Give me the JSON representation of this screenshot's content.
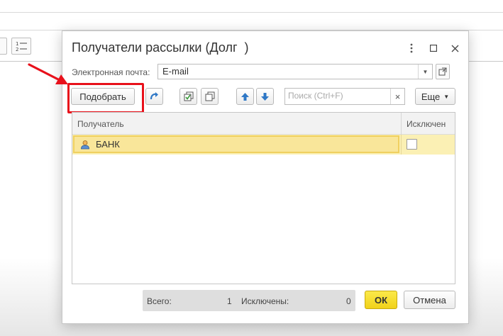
{
  "dialog": {
    "title": "Получатели рассылки (Долг  )",
    "email_label": "Электронная почта:",
    "email_value": "E-mail",
    "toolbar": {
      "pick_label": "Подобрать",
      "search_placeholder": "Поиск (Ctrl+F)",
      "more_label": "Еще"
    },
    "table": {
      "columns": [
        "Получатель",
        "Исключен"
      ],
      "rows": [
        {
          "recipient": "БАНК",
          "excluded": false
        }
      ]
    },
    "summary": {
      "total_label": "Всего:",
      "total_value": "1",
      "excluded_label": "Исключены:",
      "excluded_value": "0"
    },
    "ok_label": "ОК",
    "cancel_label": "Отмена"
  },
  "colors": {
    "highlight": "#e8111b",
    "selected_row": "#fbf0b4",
    "ok_button": "#f5dc2a",
    "arrow_icon": "#2f78c6"
  },
  "icons": [
    "more-vert-icon",
    "maximize-icon",
    "close-icon",
    "open-icon",
    "redo-icon",
    "check-all-icon",
    "copy-icon",
    "arrow-up-icon",
    "arrow-down-icon",
    "clear-icon",
    "person-icon"
  ]
}
